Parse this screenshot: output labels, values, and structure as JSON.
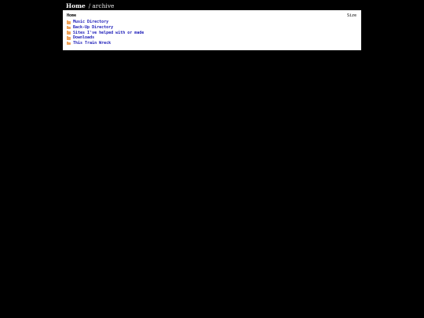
{
  "breadcrumb": {
    "home_label": "Home",
    "separator": "/",
    "current": "archive"
  },
  "header": {
    "name_label": "Home",
    "size_label": "Size"
  },
  "items": [
    {
      "label": "Music Directory",
      "icon": "folder-icon"
    },
    {
      "label": "Back-Up Directory",
      "icon": "folder-icon"
    },
    {
      "label": "Sites I've helped with or made",
      "icon": "folder-icon"
    },
    {
      "label": "Downloads",
      "icon": "folder-icon"
    },
    {
      "label": "This Train Wreck",
      "icon": "folder-icon"
    }
  ],
  "colors": {
    "background": "#000000",
    "panel": "#ffffff",
    "link": "#1a1ab8",
    "folder": "#f0a35a"
  }
}
